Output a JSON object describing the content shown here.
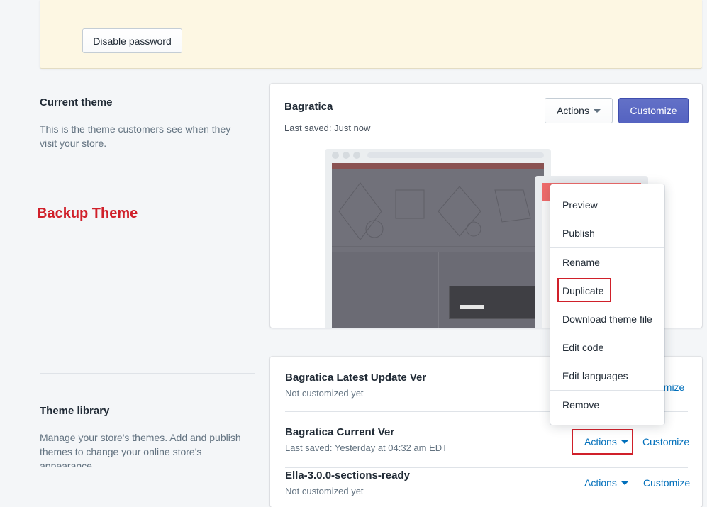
{
  "password_banner": {
    "disable_button": "Disable password"
  },
  "current_theme": {
    "heading": "Current theme",
    "description_line1": "This is the theme customers see when they",
    "description_line2": "visit your store.",
    "name": "Bagratica",
    "saved": "Last saved: Just now",
    "actions_label": "Actions",
    "customize_label": "Customize"
  },
  "annotation": {
    "label": "Backup Theme",
    "color": "#d0202a"
  },
  "actions_menu": {
    "items": [
      "Preview",
      "Publish",
      "Rename",
      "Duplicate",
      "Download theme file",
      "Edit code",
      "Edit languages",
      "Remove"
    ],
    "highlighted": "Duplicate"
  },
  "theme_library": {
    "heading": "Theme library",
    "description_line1": "Manage your store's themes. Add and publish",
    "description_line2": "themes to change your online store's",
    "description_line3": "appearance.",
    "themes": [
      {
        "name": "Bagratica Latest Update Ver",
        "status": "Not customized yet",
        "customize_label": "Customize",
        "customize_partial": "omize"
      },
      {
        "name": "Bagratica Current Ver",
        "status": "Last saved: Yesterday at 04:32 am EDT",
        "actions_label": "Actions",
        "customize_label": "Customize"
      },
      {
        "name": "Ella-3.0.0-sections-ready",
        "status": "Not customized yet",
        "actions_label": "Actions",
        "customize_label": "Customize"
      }
    ]
  },
  "colors": {
    "primary": "#5c6ac4",
    "link": "#006fbb",
    "highlight": "#d0202a",
    "banner": "#fdf7e3"
  }
}
